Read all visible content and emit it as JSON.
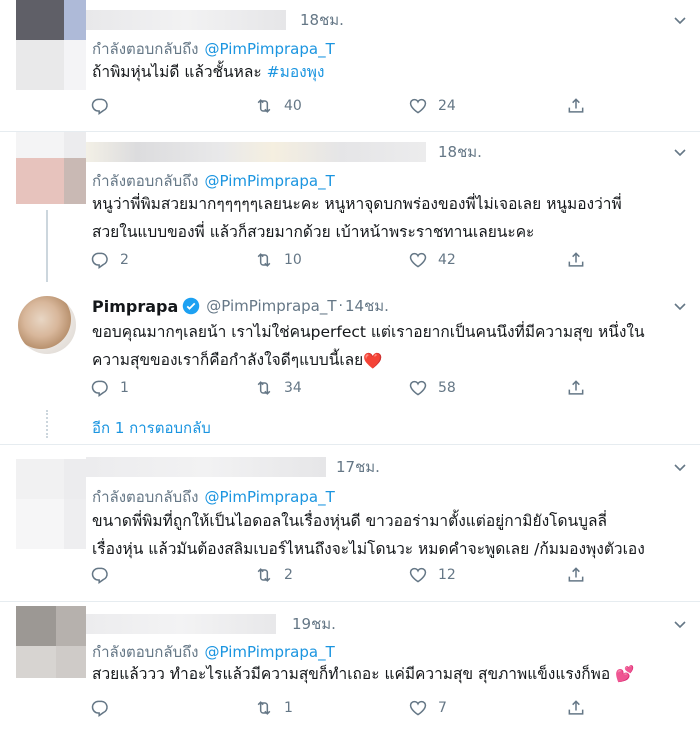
{
  "colors": {
    "link": "#1b95e0",
    "muted": "#657786",
    "text": "#14171a",
    "divider": "#e6ecf0"
  },
  "icons": {
    "reply": "reply-icon",
    "retweet": "retweet-icon",
    "like": "heart-icon",
    "share": "share-icon",
    "more": "chevron-down-icon"
  },
  "tweets": [
    {
      "time": "18ชม.",
      "replying_label": "กำลังตอบกลับถึง",
      "replying_handle": "@PimPimprapa_T",
      "text": "ถ้าพิมหุ่นไม่ดี แล้วชั้นหละ ",
      "hashtag": "#มองพุง",
      "reply_count": "",
      "retweet_count": "40",
      "like_count": "24"
    },
    {
      "time": "18ชม.",
      "replying_label": "กำลังตอบกลับถึง",
      "replying_handle": "@PimPimprapa_T",
      "text_line1": "หนูว่าพี่พิมสวยมากๆๆๆๆๆเลยนะคะ หนูหาจุดบกพร่องของพี่ไม่เจอเลย หนูมองว่าพี่",
      "text_line2": "สวยในแบบของพี่ แล้วก็สวยมากด้วย เบ้าหน้าพระราชทานเลยนะคะ",
      "reply_count": "2",
      "retweet_count": "10",
      "like_count": "42"
    },
    {
      "name": "Pimprapa",
      "handle": "@PimPimprapa_T",
      "time": "14ชม.",
      "text_line1": "ขอบคุณมากๆเลยน้า เราไม่ใช่คนperfect แต่เราอยากเป็นคนนึงที่มีความสุข หนึ่งใน",
      "text_line2": "ความสุขของเราก็คือกำลังใจดีๆแบบนี้เลย",
      "emoji": "❤️",
      "reply_count": "1",
      "retweet_count": "34",
      "like_count": "58"
    },
    {
      "time": "17ชม.",
      "replying_label": "กำลังตอบกลับถึง",
      "replying_handle": "@PimPimprapa_T",
      "text_line1": "ขนาดพี่พิมที่ถูกให้เป็นไอดอลในเรื่องหุ่นดี ขาวออร่ามาตั้งแต่อยู่กามิยังโดนบูลลี่",
      "text_line2": "เรื่องหุ่น แล้วมันต้องสลิมเบอร์ไหนถึงจะไม่โดนวะ หมดคำจะพูดเลย /ก้มมองพุงตัวเอง",
      "reply_count": "",
      "retweet_count": "2",
      "like_count": "12"
    },
    {
      "time": "19ชม.",
      "replying_label": "กำลังตอบกลับถึง",
      "replying_handle": "@PimPimprapa_T",
      "text": "สวยแล้ววว ทำอะไรแล้วมีความสุขก็ทำเถอะ แค่มีความสุข สุขภาพแข็งแรงก็พอ ",
      "emoji": "💕",
      "reply_count": "",
      "retweet_count": "1",
      "like_count": "7"
    }
  ],
  "show_more": "อีก 1 การตอบกลับ"
}
